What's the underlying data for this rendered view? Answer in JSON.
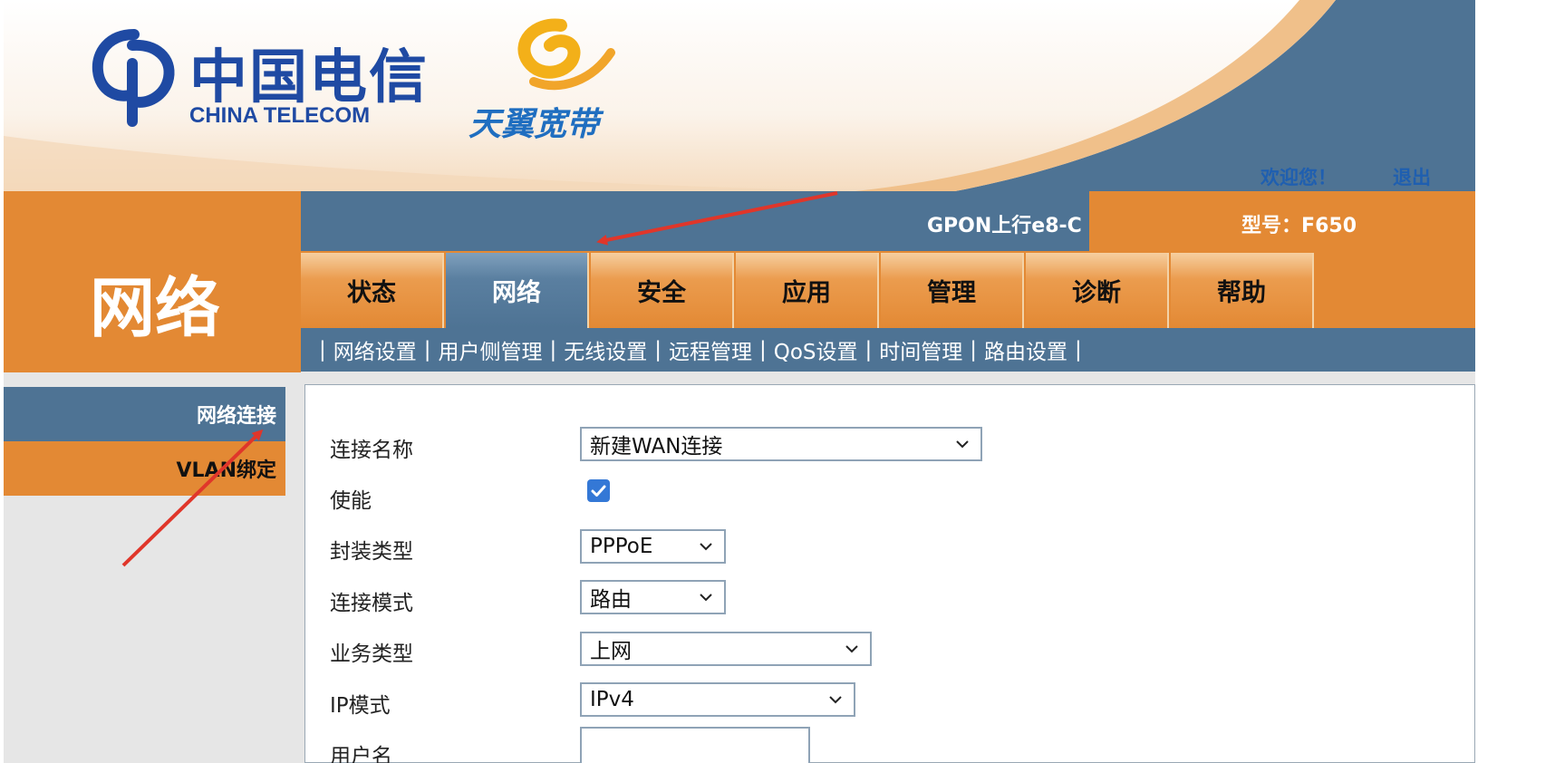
{
  "header": {
    "logo_cn": "中国电信",
    "logo_en": "CHINA TELECOM",
    "brand": "天翼宽带",
    "welcome": "欢迎您！",
    "logout": "退出"
  },
  "section_title": "网络",
  "device": {
    "line_text": "GPON上行e8-C",
    "model_text": "型号：F650"
  },
  "tabs": [
    {
      "label": "状态"
    },
    {
      "label": "网络",
      "active": true
    },
    {
      "label": "安全"
    },
    {
      "label": "应用"
    },
    {
      "label": "管理"
    },
    {
      "label": "诊断"
    },
    {
      "label": "帮助"
    }
  ],
  "submenu": {
    "separator": "|",
    "items": [
      "网络设置",
      "用户侧管理",
      "无线设置",
      "远程管理",
      "QoS设置",
      "时间管理",
      "路由设置"
    ]
  },
  "left_menu": {
    "items": [
      {
        "label": "网络连接",
        "active": true
      },
      {
        "label": "VLAN绑定"
      }
    ]
  },
  "form": {
    "connection_name": {
      "label": "连接名称",
      "value": "新建WAN连接"
    },
    "enable": {
      "label": "使能",
      "checked": true
    },
    "encapsulation": {
      "label": "封装类型",
      "value": "PPPoE"
    },
    "connection_mode": {
      "label": "连接模式",
      "value": "路由"
    },
    "service_type": {
      "label": "业务类型",
      "value": "上网"
    },
    "ip_mode": {
      "label": "IP模式",
      "value": "IPv4"
    },
    "username": {
      "label": "用户名",
      "value": ""
    }
  },
  "colors": {
    "orange": "#e38934",
    "steel_blue": "#4e7394",
    "link_blue": "#1f5fb0",
    "annotation_red": "#e0362a",
    "checkbox_blue": "#3478d6"
  }
}
